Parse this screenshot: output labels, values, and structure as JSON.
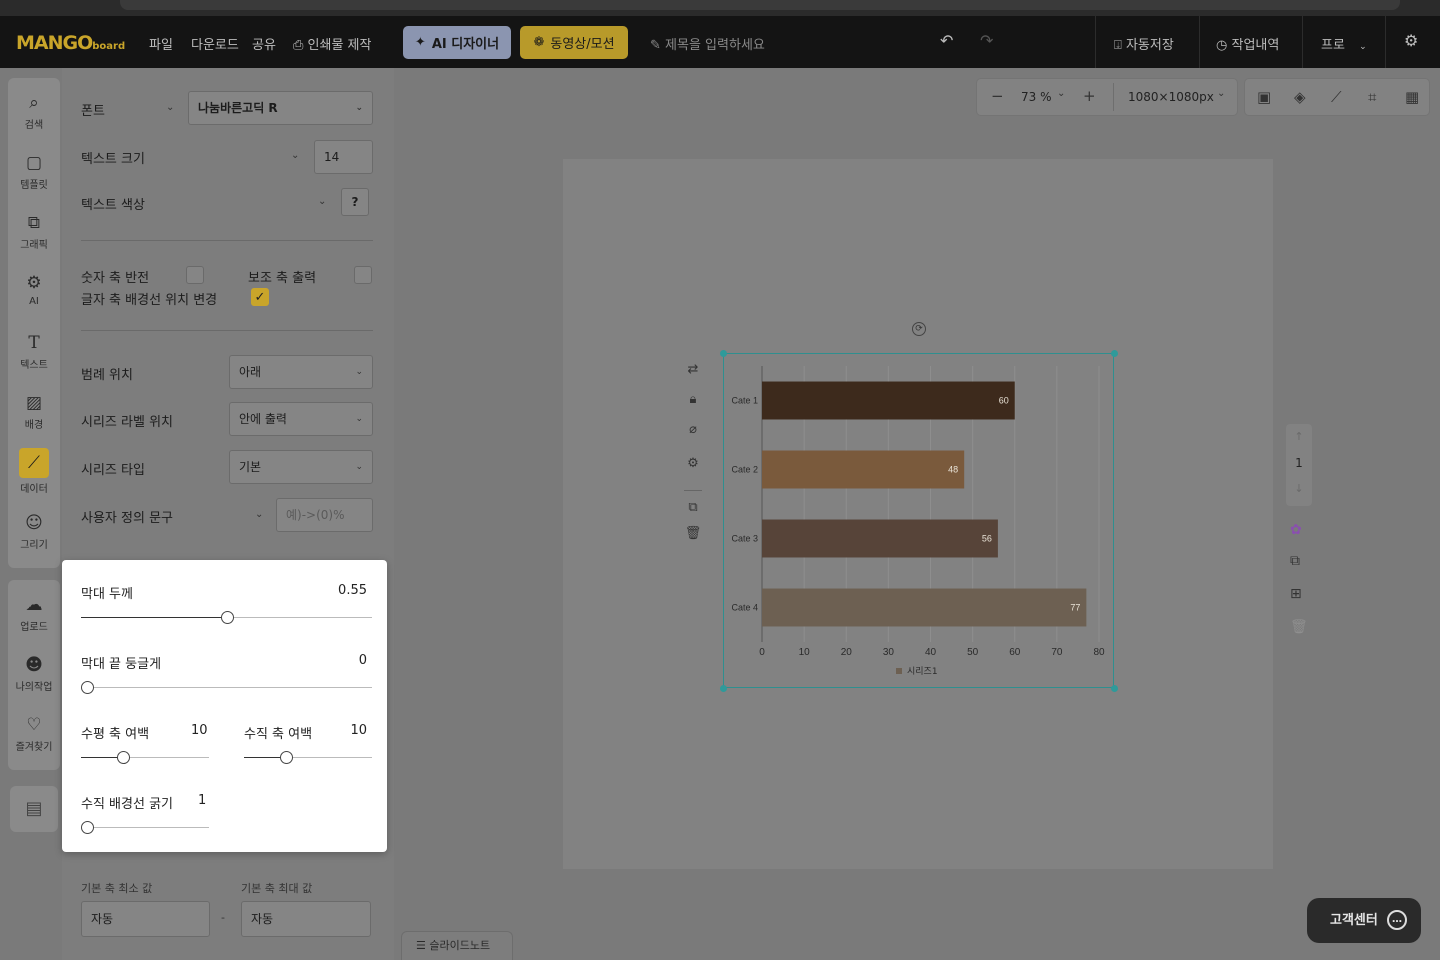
{
  "header": {
    "logo_main": "MANGO",
    "logo_sub": "board",
    "menu": [
      "파일",
      "다운로드",
      "공유"
    ],
    "print_label": "인쇄물 제작",
    "ai_designer_label": "AI 디자이너",
    "motion_label": "동영상/모션",
    "title_placeholder": "제목을 입력하세요",
    "autosave_label": "자동저장",
    "history_label": "작업내역",
    "plan_label": "프로"
  },
  "rail": {
    "items": [
      {
        "label": "검색",
        "icon": "search-icon"
      },
      {
        "label": "템플릿",
        "icon": "template-icon"
      },
      {
        "label": "그래픽",
        "icon": "graphic-icon"
      },
      {
        "label": "AI",
        "icon": "ai-icon"
      },
      {
        "label": "텍스트",
        "icon": "text-icon"
      },
      {
        "label": "배경",
        "icon": "background-icon"
      },
      {
        "label": "데이터",
        "icon": "chart-icon"
      },
      {
        "label": "그리기",
        "icon": "draw-icon"
      }
    ],
    "items2": [
      {
        "label": "업로드",
        "icon": "upload-icon"
      },
      {
        "label": "나의작업",
        "icon": "my-work-icon"
      },
      {
        "label": "즐겨찾기",
        "icon": "favorites-icon"
      }
    ],
    "active": "데이터"
  },
  "panel": {
    "font_label": "폰트",
    "font_value": "나눔바른고딕 R",
    "text_size_label": "텍스트 크기",
    "text_size_value": "14",
    "text_color_label": "텍스트 색상",
    "text_color_help": "?",
    "invert_numeric_axis_label": "숫자 축 반전",
    "invert_numeric_axis": false,
    "secondary_axis_label": "보조 축 출력",
    "secondary_axis": false,
    "text_axis_bg_label": "글자 축 배경선 위치 변경",
    "text_axis_bg": true,
    "legend_position_label": "범례 위치",
    "legend_position_value": "아래",
    "series_label_position_label": "시리즈 라벨 위치",
    "series_label_position_value": "안에 출력",
    "series_type_label": "시리즈 타입",
    "series_type_value": "기본",
    "custom_text_label": "사용자 정의 문구",
    "custom_text_placeholder": "예)->(0)%",
    "axis_min_label": "기본 축 최소 값",
    "axis_min_value": "자동",
    "axis_max_label": "기본 축 최대 값",
    "axis_max_value": "자동",
    "range_sep": "-"
  },
  "popover": {
    "bar_thickness_label": "막대 두께",
    "bar_thickness_value": "0.55",
    "bar_thickness_fraction": 0.5,
    "bar_round_label": "막대 끝 둥글게",
    "bar_round_value": "0",
    "bar_round_fraction": 0,
    "h_axis_margin_label": "수평 축 여백",
    "h_axis_margin_value": "10",
    "h_axis_margin_fraction": 0.33,
    "v_axis_margin_label": "수직 축 여백",
    "v_axis_margin_value": "10",
    "v_axis_margin_fraction": 0.33,
    "v_grid_width_label": "수직 배경선 굵기",
    "v_grid_width_value": "1",
    "v_grid_width_fraction": 0
  },
  "canvas": {
    "zoom_value": "73 %",
    "size_value": "1080×1080px",
    "page_number": "1"
  },
  "chart_data": {
    "type": "bar",
    "orientation": "horizontal",
    "categories": [
      "Cate 1",
      "Cate 2",
      "Cate 3",
      "Cate 4"
    ],
    "series": [
      {
        "name": "시리즈1",
        "values": [
          60,
          48,
          56,
          77
        ]
      }
    ],
    "xlim": [
      0,
      80
    ],
    "xticks": [
      "0",
      "10",
      "20",
      "30",
      "40",
      "50",
      "60",
      "70",
      "80"
    ],
    "bar_colors": [
      "#3d2a1c",
      "#7a5a3c",
      "#574439",
      "#6d6052"
    ],
    "grid": true,
    "legend": "bottom",
    "labels": "inside"
  },
  "footer": {
    "help_label": "고객센터",
    "slide_note_label": "슬라이드노트"
  }
}
